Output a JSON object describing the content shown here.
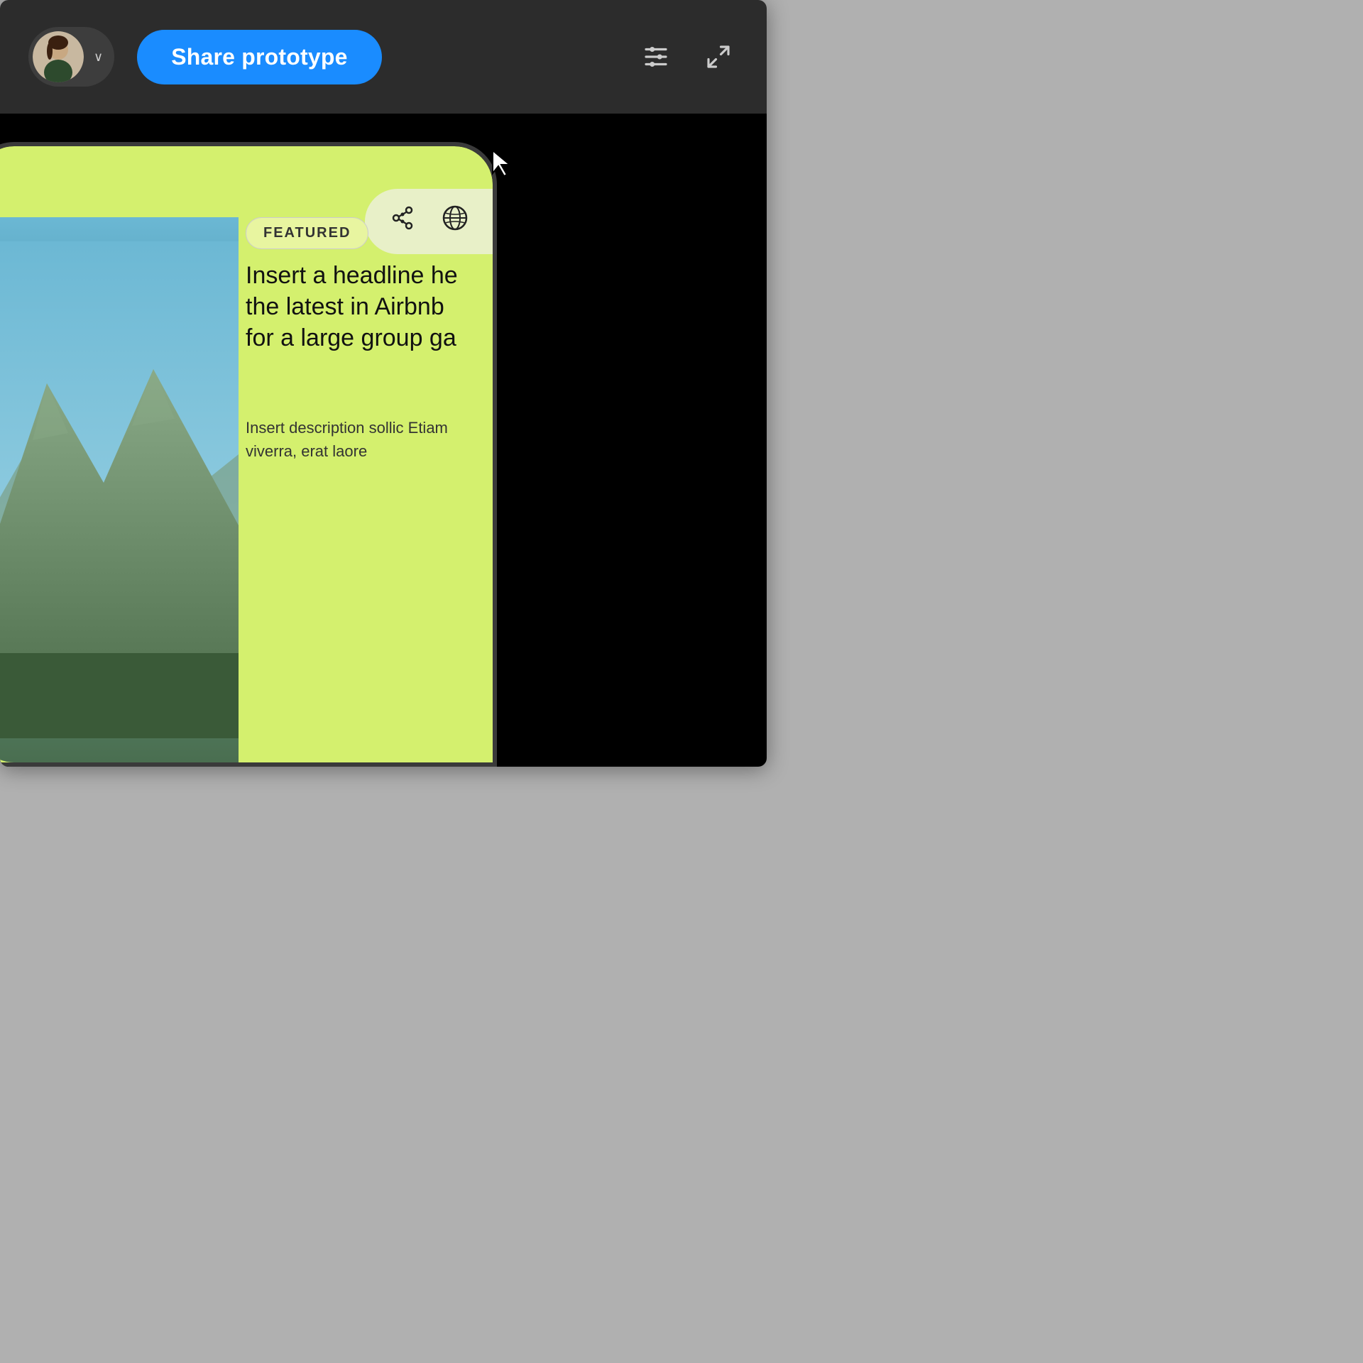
{
  "topbar": {
    "share_button_label": "Share prototype",
    "chevron": "∨",
    "bg_color": "#2c2c2c",
    "share_btn_color": "#1a8cff"
  },
  "icons": {
    "sliders": "sliders-icon",
    "expand": "expand-icon",
    "network": "⦾",
    "globe": "🌐"
  },
  "device": {
    "bg_color": "#1a1a1a",
    "screen_color": "#d4f06e"
  },
  "app_content": {
    "featured_label": "FEATURED",
    "headline": "Insert a headline he the latest in Airbnb for a large group ga",
    "description": "Insert description sollic Etiam viverra, erat laore"
  }
}
